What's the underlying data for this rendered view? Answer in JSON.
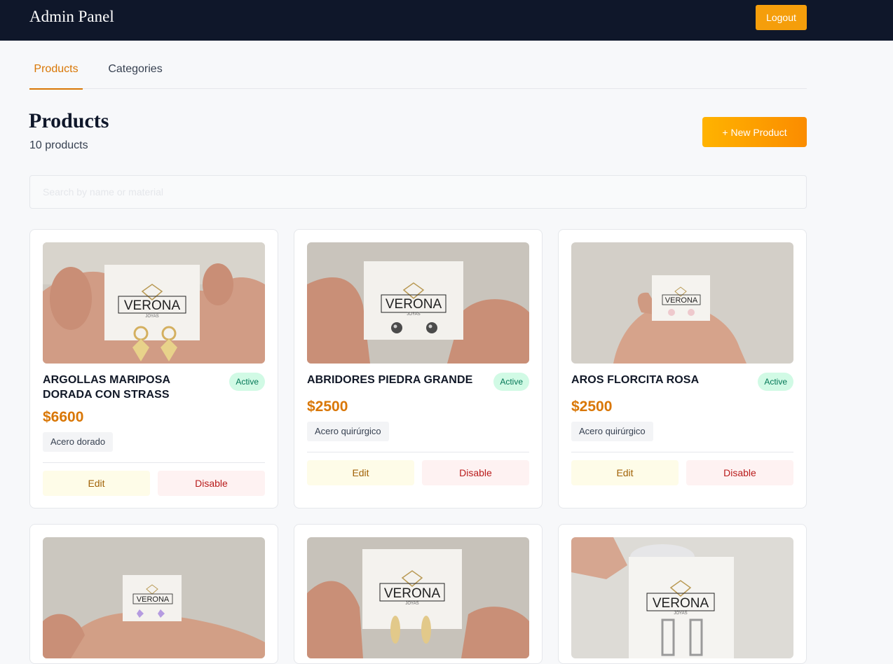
{
  "header": {
    "brand": "Admin Panel",
    "logout_label": "Logout"
  },
  "tabs": [
    {
      "label": "Products",
      "active": true
    },
    {
      "label": "Categories",
      "active": false
    }
  ],
  "page": {
    "title": "Products",
    "count_text": "10 products",
    "new_button_label": "+ New Product"
  },
  "search": {
    "placeholder": "Search by name or material",
    "value": ""
  },
  "brand_on_card": {
    "name": "VERONA",
    "sub": "JOYAS"
  },
  "actions": {
    "edit_label": "Edit",
    "disable_label": "Disable"
  },
  "products": [
    {
      "name": "ARGOLLAS MARIPOSA DORADA CON STRASS",
      "status": "Active",
      "price": "$6600",
      "material": "Acero dorado"
    },
    {
      "name": "ABRIDORES PIEDRA GRANDE",
      "status": "Active",
      "price": "$2500",
      "material": "Acero quirúrgico"
    },
    {
      "name": "AROS FLORCITA ROSA",
      "status": "Active",
      "price": "$2500",
      "material": "Acero quirúrgico"
    }
  ],
  "colors": {
    "accent": "#d97706",
    "topbar": "#0f172a",
    "logout": "#f59e0b",
    "active_badge_bg": "#d1fae5",
    "active_badge_text": "#047857"
  }
}
